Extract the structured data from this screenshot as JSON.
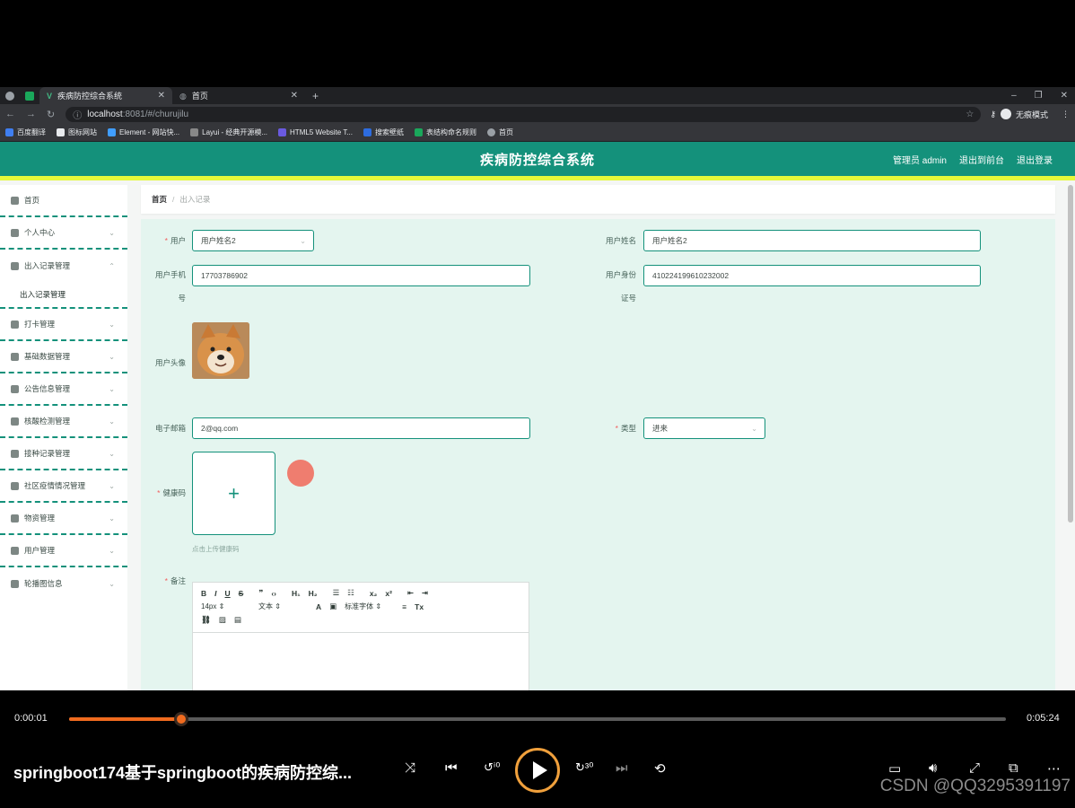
{
  "browser": {
    "tabs": [
      {
        "label": "疾病防控综合系统",
        "active": true
      },
      {
        "label": "首页",
        "active": false
      }
    ],
    "url_host": "localhost",
    "url_path": ":8081/#/churujilu",
    "incognito_label": "无痕模式",
    "bookmarks": [
      "百度翻译",
      "图标网站",
      "Element - 网站快...",
      "Layui - 经典开源模...",
      "HTML5 Website T...",
      "搜索壁纸",
      "表结构命名规则",
      "首页"
    ]
  },
  "app": {
    "title": "疾病防控综合系统",
    "admin_label": "管理员 admin",
    "back_link": "退出到前台",
    "logout_link": "退出登录",
    "accent_color": "#14917b"
  },
  "sidebar": {
    "items": [
      {
        "label": "首页",
        "icon": "home-icon",
        "expandable": false
      },
      {
        "label": "个人中心",
        "icon": "user-icon",
        "expandable": true
      },
      {
        "label": "出入记录管理",
        "icon": "send-icon",
        "expandable": true,
        "expanded": true
      },
      {
        "label": "打卡管理",
        "icon": "briefcase-icon",
        "expandable": true
      },
      {
        "label": "基础数据管理",
        "icon": "clipboard-icon",
        "expandable": true
      },
      {
        "label": "公告信息管理",
        "icon": "copy-icon",
        "expandable": true
      },
      {
        "label": "核酸检测管理",
        "icon": "bar-chart-icon",
        "expandable": true
      },
      {
        "label": "接种记录管理",
        "icon": "crop-icon",
        "expandable": true
      },
      {
        "label": "社区疫情情况管理",
        "icon": "chart-icon",
        "expandable": true
      },
      {
        "label": "物资管理",
        "icon": "box-icon",
        "expandable": true
      },
      {
        "label": "用户管理",
        "icon": "doc-icon",
        "expandable": true
      },
      {
        "label": "轮播图信息",
        "icon": "sliders-icon",
        "expandable": true
      }
    ],
    "sub_item": "出入记录管理"
  },
  "breadcrumb": {
    "home": "首页",
    "separator": "/",
    "current": "出入记录"
  },
  "form": {
    "user_label": "用户",
    "user_value": "用户姓名2",
    "user_name_label": "用户姓名",
    "user_name_value": "用户姓名2",
    "phone_label_1": "用户手机",
    "phone_label_2": "号",
    "phone_value": "17703786902",
    "id_label_1": "用户身份",
    "id_label_2": "证号",
    "id_value": "410224199610232002",
    "avatar_label": "用户头像",
    "email_label": "电子邮箱",
    "email_value": "2@qq.com",
    "type_label": "类型",
    "type_value": "进来",
    "health_code_label": "健康码",
    "health_code_hint": "点击上传健康码",
    "remark_label": "备注",
    "editor": {
      "font_size": "14px",
      "text_style": "文本",
      "font_family": "标准字体"
    }
  },
  "player": {
    "current_time": "0:00:01",
    "total_time": "0:05:24",
    "progress": 0.12,
    "title": "springboot174基于springboot的疾病防控综...",
    "watermark": "CSDN @QQ3295391197"
  }
}
